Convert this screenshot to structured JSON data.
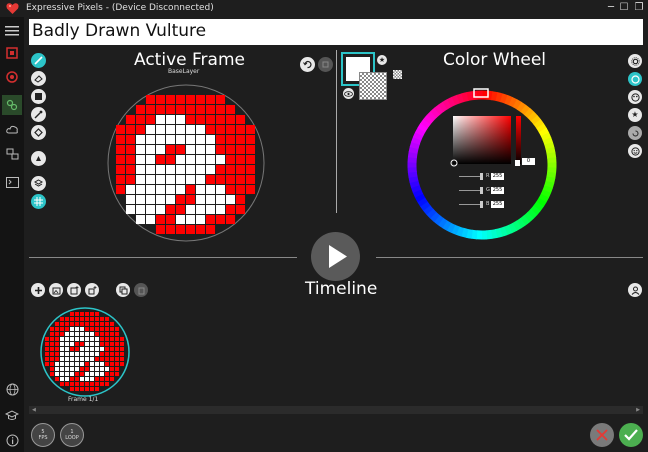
{
  "window": {
    "title": "Expressive Pixels - (Device Disconnected)"
  },
  "animation_name": "Badly Drawn Vulture",
  "active_frame": {
    "title": "Active Frame",
    "layer": "BaseLayer"
  },
  "color_wheel": {
    "title": "Color Wheel",
    "sliders": [
      {
        "channel": "R",
        "value": "255"
      },
      {
        "channel": "G",
        "value": "255"
      },
      {
        "channel": "B",
        "value": "255"
      }
    ],
    "alpha_value": "0"
  },
  "timeline": {
    "title": "Timeline",
    "frame_label": "Frame 1/1"
  },
  "bottom": {
    "fps_value": "5",
    "fps_label": "FPS",
    "loop_value": "1",
    "loop_label": "LOOP"
  },
  "colors": {
    "accent": "#2cc4c8",
    "pixel_red": "#ff0000",
    "pixel_white": "#ffffff",
    "confirm": "#4caf50",
    "cancel": "#7a7a7a"
  }
}
